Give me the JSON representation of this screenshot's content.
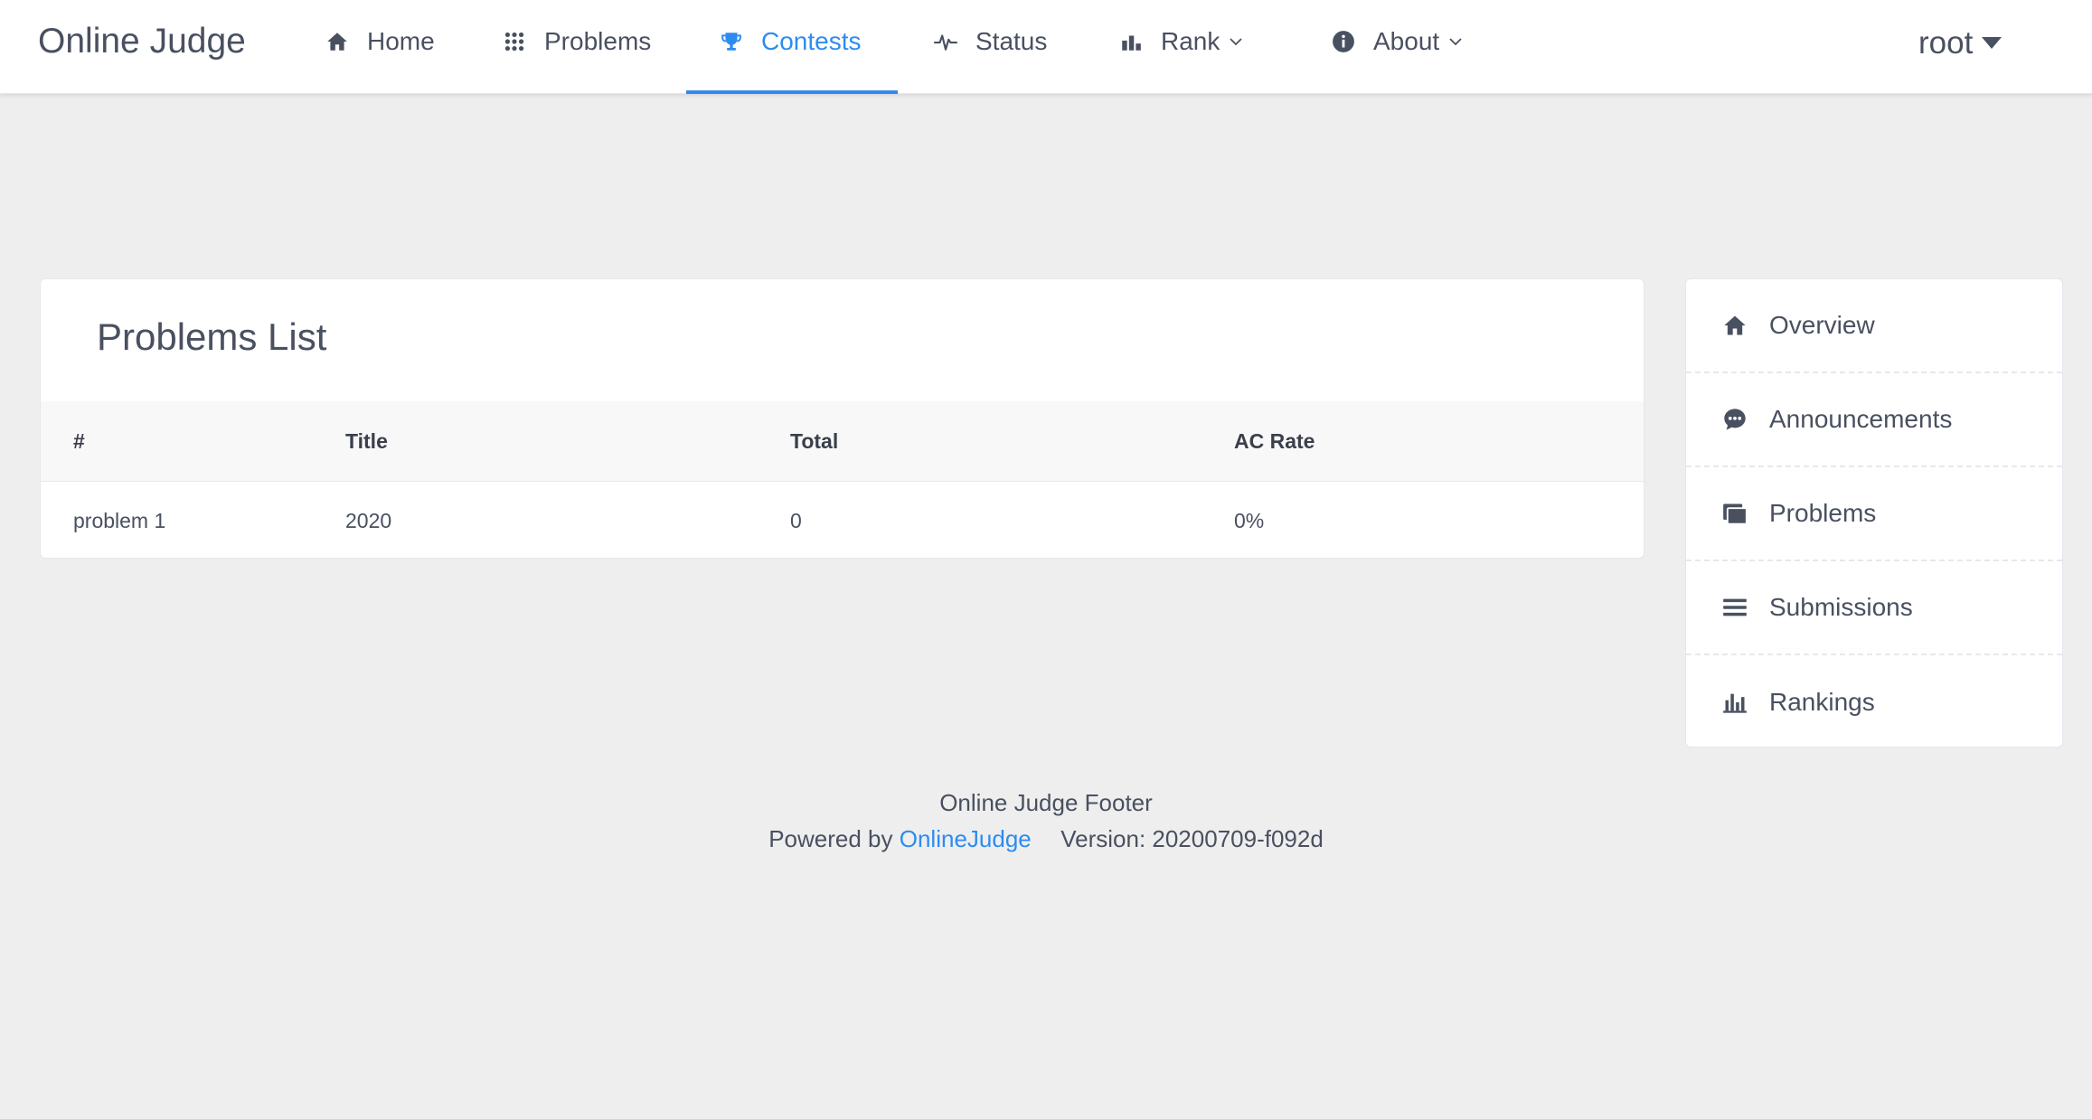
{
  "app": {
    "title": "Online Judge"
  },
  "colors": {
    "accent": "#2d8cf0",
    "text": "#495060",
    "background": "#eeeeee"
  },
  "nav": {
    "items": [
      {
        "label": "Home",
        "icon": "home-icon"
      },
      {
        "label": "Problems",
        "icon": "grid-icon"
      },
      {
        "label": "Contests",
        "icon": "trophy-icon",
        "active": true
      },
      {
        "label": "Status",
        "icon": "pulse-icon"
      },
      {
        "label": "Rank",
        "icon": "bar-chart-icon",
        "dropdown": true
      },
      {
        "label": "About",
        "icon": "info-icon",
        "dropdown": true
      }
    ],
    "user": {
      "name": "root"
    }
  },
  "problems_list": {
    "title": "Problems List",
    "columns": [
      "#",
      "Title",
      "Total",
      "AC Rate"
    ],
    "rows": [
      [
        "problem 1",
        "2020",
        "0",
        "0%"
      ]
    ]
  },
  "side_menu": {
    "items": [
      {
        "label": "Overview",
        "icon": "home-icon"
      },
      {
        "label": "Announcements",
        "icon": "chat-bubble-icon"
      },
      {
        "label": "Problems",
        "icon": "stack-icon"
      },
      {
        "label": "Submissions",
        "icon": "list-icon"
      },
      {
        "label": "Rankings",
        "icon": "bar-chart-icon"
      }
    ]
  },
  "footer": {
    "line1": "Online Judge Footer",
    "powered_prefix": "Powered by",
    "powered_link": "OnlineJudge",
    "version": "Version: 20200709-f092d"
  }
}
